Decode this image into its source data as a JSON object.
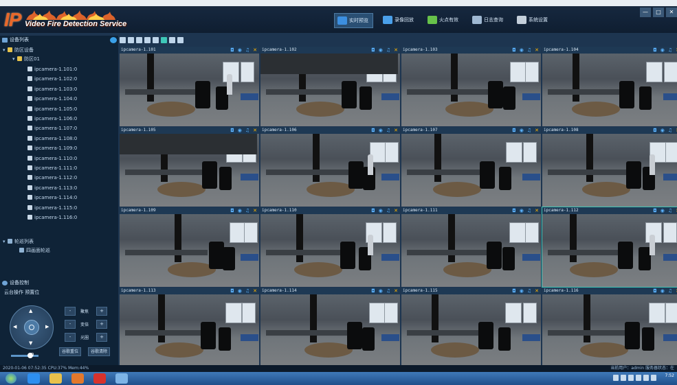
{
  "app": {
    "logo_text": "IP",
    "title": "Video Fire Detection Service"
  },
  "nav": [
    {
      "label": "实时预览",
      "icon": "monitor-icon",
      "active": true
    },
    {
      "label": "录像回放",
      "icon": "playback-icon",
      "active": false
    },
    {
      "label": "火点有效",
      "icon": "fire-map-icon",
      "active": false
    },
    {
      "label": "日志查询",
      "icon": "search-icon",
      "active": false
    },
    {
      "label": "系统设置",
      "icon": "gear-icon",
      "active": false
    }
  ],
  "window_controls": [
    "—",
    "□",
    "✕"
  ],
  "left_panel": {
    "device_list_title": "设备列表",
    "tree": {
      "root": "防区设备",
      "zone": "防区01",
      "cameras": [
        "ipcamera-1.101:0",
        "ipcamera-1.102:0",
        "ipcamera-1.103:0",
        "ipcamera-1.104:0",
        "ipcamera-1.105:0",
        "ipcamera-1.106:0",
        "ipcamera-1.107:0",
        "ipcamera-1.108:0",
        "ipcamera-1.109:0",
        "ipcamera-1.110:0",
        "ipcamera-1.111:0",
        "ipcamera-1.112:0",
        "ipcamera-1.113:0",
        "ipcamera-1.114:0",
        "ipcamera-1.115:0",
        "ipcamera-1.116:0"
      ],
      "tour_group": "轮巡列表",
      "tour_item": "四画面轮巡"
    },
    "ptz": {
      "title": "设备控制",
      "tabs": "云台操作  预置位",
      "rows": [
        {
          "minus": "-",
          "label": "聚焦",
          "plus": "+"
        },
        {
          "minus": "-",
          "label": "变倍",
          "plus": "+"
        },
        {
          "minus": "-",
          "label": "光圈",
          "plus": "+"
        }
      ],
      "reset_btn": "谷歌重位",
      "clear_btn": "谷歌清除",
      "speed_value": "0"
    }
  },
  "grid": {
    "cells": [
      "ipcamera-1.101",
      "ipcamera-1.102",
      "ipcamera-1.103",
      "ipcamera-1.104",
      "ipcamera-1.105",
      "ipcamera-1.106",
      "ipcamera-1.107",
      "ipcamera-1.108",
      "ipcamera-1.109",
      "ipcamera-1.110",
      "ipcamera-1.111",
      "ipcamera-1.112",
      "ipcamera-1.113",
      "ipcamera-1.114",
      "ipcamera-1.115",
      "ipcamera-1.116"
    ],
    "selected_index": 11,
    "icons": [
      "camera-icon",
      "record-icon",
      "audio-icon",
      "close-icon"
    ]
  },
  "status_bar": {
    "left": "2020-01-06 07:52:35 CPU:37% Mem:44%",
    "right": "当前用户：admin 服务器状态：在"
  },
  "taskbar": {
    "time": "7:52"
  }
}
